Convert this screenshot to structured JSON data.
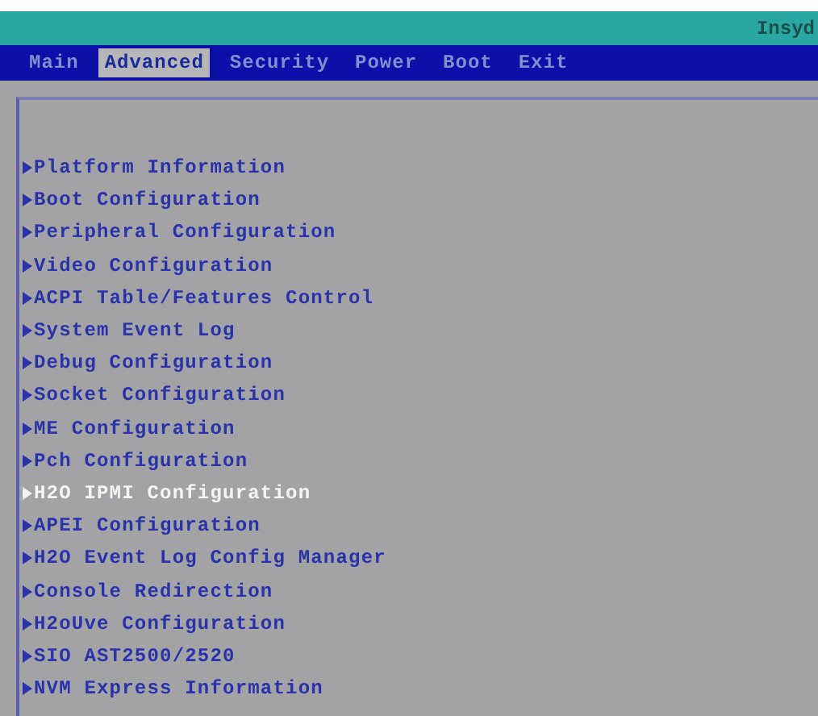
{
  "header": {
    "brand": "Insyd"
  },
  "tabs": [
    {
      "label": "Main",
      "selected": false
    },
    {
      "label": "Advanced",
      "selected": true
    },
    {
      "label": "Security",
      "selected": false
    },
    {
      "label": "Power",
      "selected": false
    },
    {
      "label": "Boot",
      "selected": false
    },
    {
      "label": "Exit",
      "selected": false
    }
  ],
  "menu_items": [
    {
      "label": "Platform Information",
      "selected": false
    },
    {
      "label": "Boot Configuration",
      "selected": false
    },
    {
      "label": "Peripheral Configuration",
      "selected": false
    },
    {
      "label": "Video Configuration",
      "selected": false
    },
    {
      "label": "ACPI Table/Features Control",
      "selected": false
    },
    {
      "label": "System Event Log",
      "selected": false
    },
    {
      "label": "Debug Configuration",
      "selected": false
    },
    {
      "label": "Socket Configuration",
      "selected": false
    },
    {
      "label": "ME Configuration",
      "selected": false
    },
    {
      "label": "Pch Configuration",
      "selected": false
    },
    {
      "label": "H2O IPMI Configuration",
      "selected": true
    },
    {
      "label": "APEI Configuration",
      "selected": false
    },
    {
      "label": "H2O Event Log Config Manager",
      "selected": false
    },
    {
      "label": "Console Redirection",
      "selected": false
    },
    {
      "label": "H2oUve Configuration",
      "selected": false
    },
    {
      "label": "SIO AST2500/2520",
      "selected": false
    },
    {
      "label": "NVM Express Information",
      "selected": false
    }
  ]
}
